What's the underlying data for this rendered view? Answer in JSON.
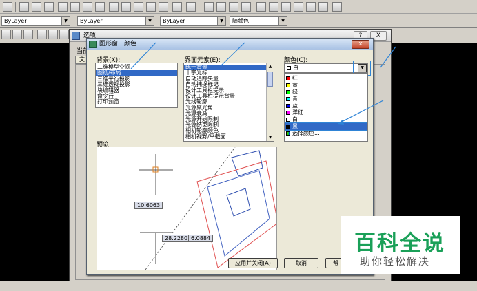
{
  "toolbar": {
    "layer1_value": "ByLayer",
    "linetype_value": "ByLayer",
    "lineweight_value": "ByLayer",
    "color_value": "随颜色"
  },
  "options_dialog": {
    "title": "选项",
    "tab_fragment": "当前",
    "tab_letter": "文",
    "help_glyph": "?",
    "close_glyph": "X"
  },
  "graphics_dialog": {
    "title": "图形窗口颜色",
    "close_glyph": "x",
    "background_label": "背景(X):",
    "background_items": [
      "二维模型空间",
      "图纸/布局",
      "三维平行投影",
      "三维透视投影",
      "块编辑器",
      "命令行",
      "打印预览"
    ],
    "background_selected_index": 1,
    "elements_label": "界面元素(E):",
    "element_items": [
      "统一背景",
      "十字光标",
      "自动追踪矢量",
      "自动捕捉标记",
      "设计工具栏提示",
      "设计工具栏提示背景",
      "光线轮廓",
      "光源聚光角",
      "光源衰减",
      "光源开始限制",
      "光源结束限制",
      "相机轮廓颜色",
      "相机视野/平截面"
    ],
    "element_selected_index": 0,
    "color_label": "颜色(C):",
    "color_current": "白",
    "color_options": [
      {
        "name": "红",
        "hex": "#ff0000"
      },
      {
        "name": "黄",
        "hex": "#ffff00"
      },
      {
        "name": "绿",
        "hex": "#00ff00"
      },
      {
        "name": "青",
        "hex": "#00ffff"
      },
      {
        "name": "蓝",
        "hex": "#0000ff"
      },
      {
        "name": "洋红",
        "hex": "#ff00ff"
      },
      {
        "name": "白",
        "hex": "#ffffff"
      },
      {
        "name": "黑",
        "hex": "#000000"
      }
    ],
    "color_selected_index": 7,
    "color_more": "选择颜色...",
    "preview_label": "预览:",
    "preview_values": {
      "val1": "10.6063",
      "val2": "28.2280",
      "val3": "6.0884"
    },
    "apply_button": "应用并关闭(A)",
    "cancel_button": "取消",
    "help_fragment": "帮"
  },
  "watermark": {
    "title": "百科全说",
    "subtitle": "助你轻松解决"
  },
  "colors": {
    "selection": "#3169c6",
    "highlight_box": "#2f84d6",
    "watermark_green": "#1aa058"
  }
}
